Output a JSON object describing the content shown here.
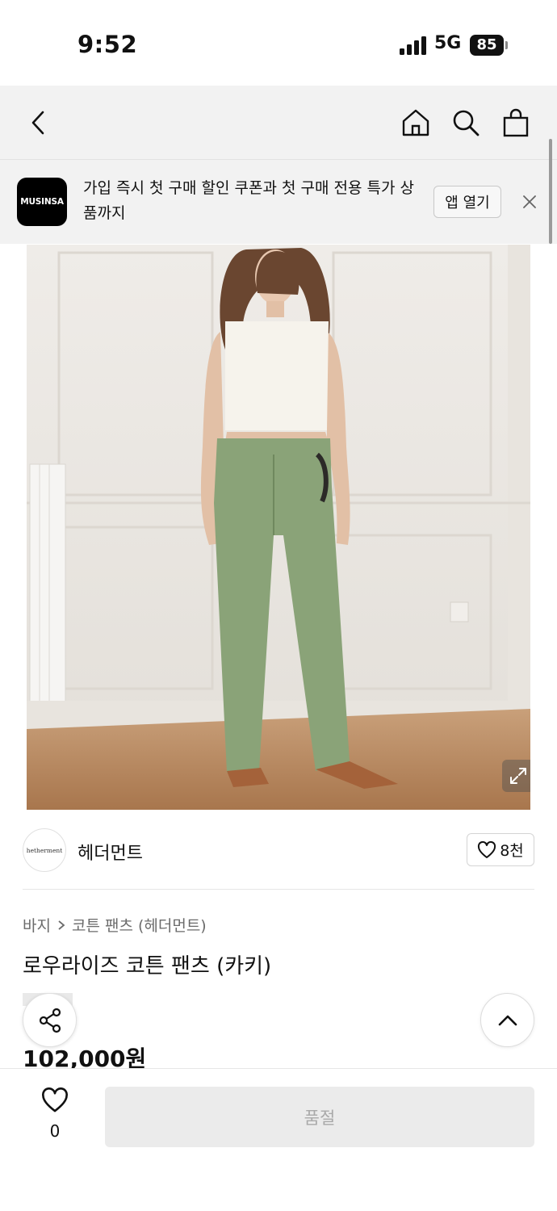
{
  "status_bar": {
    "time": "9:52",
    "network": "5G",
    "battery": "85"
  },
  "nav": {
    "back": "back-icon",
    "home": "home-icon",
    "search": "search-icon",
    "cart": "shopping-bag-icon"
  },
  "banner": {
    "logo_text": "MUSINSA",
    "message": "가입 즉시 첫 구매 할인 쿠폰과 첫 구매 전용 특가 상품까지",
    "open_label": "앱 열기"
  },
  "brand": {
    "logo_text": "hetherment",
    "name": "헤더먼트",
    "likes": "8천"
  },
  "breadcrumb": {
    "category": "바지",
    "subcategory": "코튼 팬츠 (헤더먼트)"
  },
  "product": {
    "title": "로우라이즈 코튼 팬츠 (카키)",
    "price": "102,000원"
  },
  "bottom_bar": {
    "wish_count": "0",
    "buy_label": "품절"
  },
  "colors": {
    "accent": "#000000",
    "disabled_bg": "#ebebeb",
    "disabled_text": "#a9a9a9",
    "banner_bg": "#f2f2f2",
    "pants_khaki": "#8aa378"
  }
}
